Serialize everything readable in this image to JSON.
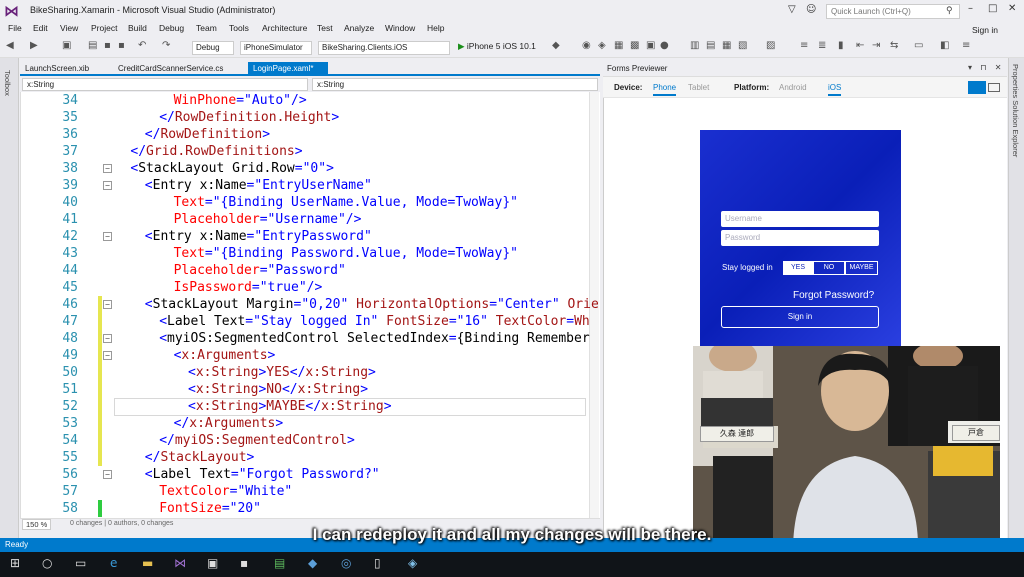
{
  "window": {
    "title": "BikeSharing.Xamarin - Microsoft Visual Studio (Administrator)",
    "quick_launch_placeholder": "Quick Launch (Ctrl+Q)",
    "sign_in": "Sign in"
  },
  "menu": [
    "File",
    "Edit",
    "View",
    "Project",
    "Build",
    "Debug",
    "Team",
    "Tools",
    "Architecture",
    "Test",
    "Analyze",
    "Window",
    "Help"
  ],
  "toolbar": {
    "config": "Debug",
    "platform": "iPhoneSimulator",
    "project": "BikeSharing.Clients.iOS",
    "run_target": "iPhone 5 iOS 10.1"
  },
  "side_rail": {
    "left_label": "Toolbox",
    "right_label": "Properties    Solution Explorer"
  },
  "tabs": [
    {
      "label": "LaunchScreen.xib",
      "active": false
    },
    {
      "label": "CreditCardScannerService.cs",
      "active": false
    },
    {
      "label": "LoginPage.xaml*",
      "active": true
    }
  ],
  "nav": {
    "left": "x:String",
    "right": "x:String"
  },
  "code_lines": [
    {
      "n": "34",
      "indent": 8,
      "text": "WinPhone=\"Auto\"/>",
      "fold": ""
    },
    {
      "n": "35",
      "indent": 6,
      "text": "</RowDefinition.Height>",
      "fold": ""
    },
    {
      "n": "36",
      "indent": 4,
      "text": "</RowDefinition>",
      "fold": ""
    },
    {
      "n": "37",
      "indent": 2,
      "text": "</Grid.RowDefinitions>",
      "fold": ""
    },
    {
      "n": "38",
      "indent": 2,
      "text": "<StackLayout Grid.Row=\"0\">",
      "fold": "−"
    },
    {
      "n": "39",
      "indent": 4,
      "text": "<Entry x:Name=\"EntryUserName\"",
      "fold": "−"
    },
    {
      "n": "40",
      "indent": 8,
      "text": "Text=\"{Binding UserName.Value, Mode=TwoWay}\"",
      "fold": ""
    },
    {
      "n": "41",
      "indent": 8,
      "text": "Placeholder=\"Username\"/>",
      "fold": ""
    },
    {
      "n": "42",
      "indent": 4,
      "text": "<Entry x:Name=\"EntryPassword\"",
      "fold": "−"
    },
    {
      "n": "43",
      "indent": 8,
      "text": "Text=\"{Binding Password.Value, Mode=TwoWay}\"",
      "fold": ""
    },
    {
      "n": "44",
      "indent": 8,
      "text": "Placeholder=\"Password\"",
      "fold": ""
    },
    {
      "n": "45",
      "indent": 8,
      "text": "IsPassword=\"true\"/>",
      "fold": ""
    },
    {
      "n": "46",
      "indent": 4,
      "text": "<StackLayout Margin=\"0,20\" HorizontalOptions=\"Center\" Orient",
      "fold": "−"
    },
    {
      "n": "47",
      "indent": 6,
      "text": "<Label Text=\"Stay logged In\" FontSize=\"16\" TextColor=\"Wh",
      "fold": ""
    },
    {
      "n": "48",
      "indent": 6,
      "text": "<myiOS:SegmentedControl SelectedIndex=\"{Binding Remember",
      "fold": "−"
    },
    {
      "n": "49",
      "indent": 8,
      "text": "<x:Arguments>",
      "fold": "−"
    },
    {
      "n": "50",
      "indent": 10,
      "text": "<x:String>YES</x:String>",
      "fold": ""
    },
    {
      "n": "51",
      "indent": 10,
      "text": "<x:String>NO</x:String>",
      "fold": ""
    },
    {
      "n": "52",
      "indent": 10,
      "text": "<x:String>MAYBE</x:String>",
      "fold": ""
    },
    {
      "n": "53",
      "indent": 8,
      "text": "</x:Arguments>",
      "fold": ""
    },
    {
      "n": "54",
      "indent": 6,
      "text": "</myiOS:SegmentedControl>",
      "fold": ""
    },
    {
      "n": "55",
      "indent": 4,
      "text": "</StackLayout>",
      "fold": ""
    },
    {
      "n": "56",
      "indent": 4,
      "text": "<Label Text=\"Forgot Password?\"",
      "fold": "−"
    },
    {
      "n": "57",
      "indent": 6,
      "text": "TextColor=\"White\"",
      "fold": ""
    },
    {
      "n": "58",
      "indent": 6,
      "text": "FontSize=\"20\"",
      "fold": ""
    }
  ],
  "editor_status": {
    "zoom": "150 %",
    "changes": "0 changes | 0 authors, 0 changes"
  },
  "forms_previewer": {
    "title": "Forms Previewer",
    "device_label": "Device:",
    "device_options": [
      "Phone",
      "Tablet"
    ],
    "platform_label": "Platform:",
    "platform_options": [
      "Android",
      "iOS"
    ]
  },
  "phone_preview": {
    "username_placeholder": "Username",
    "password_placeholder": "Password",
    "stay_logged_in": "Stay logged in",
    "segments": [
      "YES",
      "NO",
      "MAYBE"
    ],
    "forgot": "Forgot Password?",
    "sign_in_button": "Sign in"
  },
  "camera": {
    "badge1": "久森 達郎",
    "badge2": "戸倉 "
  },
  "status": {
    "left": "Ready"
  },
  "subtitle": "I can redeploy it and all my changes will be there."
}
